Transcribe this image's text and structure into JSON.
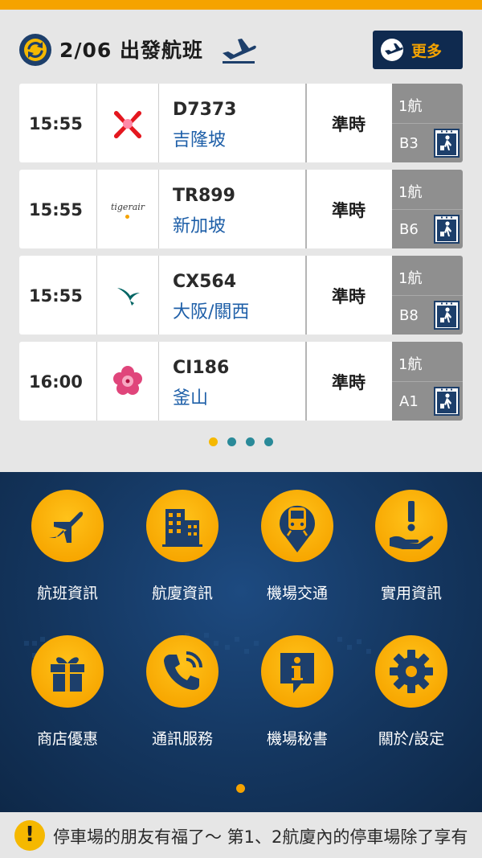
{
  "header": {
    "title": "2/06 出發航班",
    "more_label": "更多"
  },
  "flights": [
    {
      "time": "15:55",
      "flight_no": "D7373",
      "destination": "吉隆坡",
      "status": "準時",
      "terminal": "1航",
      "gate": "B3",
      "airline_logo": "airasia-logo"
    },
    {
      "time": "15:55",
      "flight_no": "TR899",
      "destination": "新加坡",
      "status": "準時",
      "terminal": "1航",
      "gate": "B6",
      "airline_logo": "tigerair-logo",
      "logo_text": "tigerair"
    },
    {
      "time": "15:55",
      "flight_no": "CX564",
      "destination": "大阪/關西",
      "status": "準時",
      "terminal": "1航",
      "gate": "B8",
      "airline_logo": "cathay-logo"
    },
    {
      "time": "16:00",
      "flight_no": "CI186",
      "destination": "釜山",
      "status": "準時",
      "terminal": "1航",
      "gate": "A1",
      "airline_logo": "china-airlines-logo"
    }
  ],
  "flight_pager": {
    "count": 4,
    "active": 0
  },
  "menu": {
    "items": [
      {
        "label": "航班資訊",
        "icon": "airplane-icon"
      },
      {
        "label": "航廈資訊",
        "icon": "building-icon"
      },
      {
        "label": "機場交通",
        "icon": "train-icon"
      },
      {
        "label": "實用資訊",
        "icon": "hand-info-icon"
      },
      {
        "label": "商店優惠",
        "icon": "gift-icon"
      },
      {
        "label": "通訊服務",
        "icon": "phone-icon"
      },
      {
        "label": "機場秘書",
        "icon": "info-icon"
      },
      {
        "label": "關於/設定",
        "icon": "gear-icon"
      }
    ]
  },
  "ticker": {
    "icon": "!",
    "text": "停車場的朋友有福了～ 第1、2航廈內的停車場除了享有"
  },
  "colors": {
    "accent": "#f5a300",
    "navy": "#0f2a4f",
    "destination_blue": "#1e5fa8",
    "gate_gray": "#8f8f8f",
    "pager_teal": "#2a8a99"
  }
}
